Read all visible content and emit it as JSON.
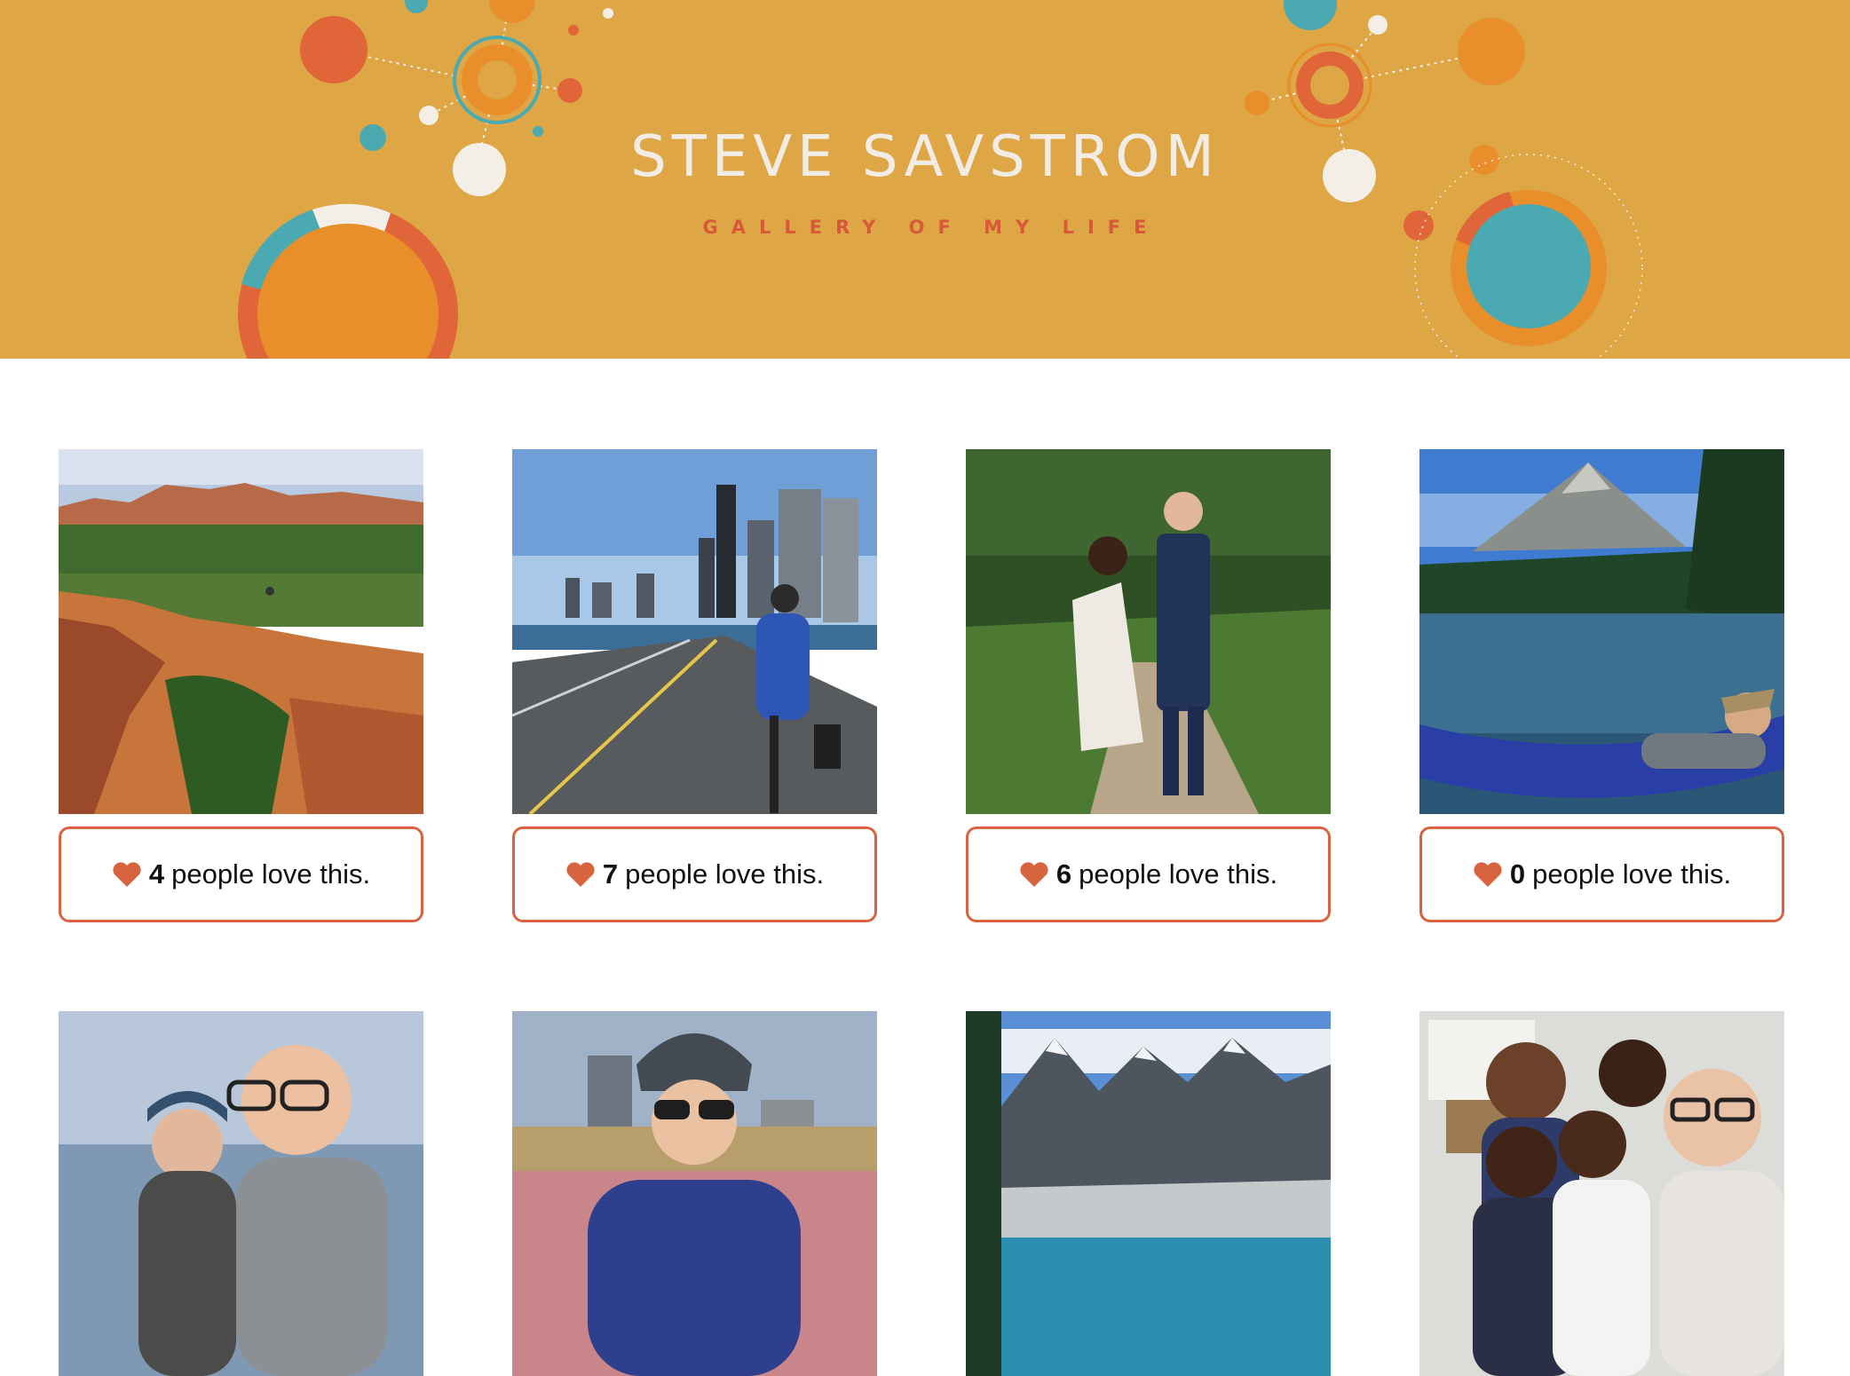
{
  "header": {
    "title": "STEVE SAVSTROM",
    "tagline": "GALLERY OF MY LIFE"
  },
  "colors": {
    "banner": "#dfa645",
    "accent": "#d8643f",
    "teal": "#4ba9b1",
    "orange": "#e88f2c"
  },
  "gallery": {
    "love_suffix": "people love this.",
    "items": [
      {
        "photo": "red rock canyon arch landscape",
        "count": "4"
      },
      {
        "photo": "cyclist on lakefront path with city skyline",
        "count": "7"
      },
      {
        "photo": "wedding couple walking on forest path",
        "count": "6"
      },
      {
        "photo": "man in hammock by mountain lake",
        "count": "0"
      },
      {
        "photo": "couple selfie by the lake",
        "count": ""
      },
      {
        "photo": "cyclist with helmet selfie",
        "count": ""
      },
      {
        "photo": "mountain valley with turquoise lake",
        "count": ""
      },
      {
        "photo": "classroom selfie with kids",
        "count": ""
      }
    ]
  }
}
